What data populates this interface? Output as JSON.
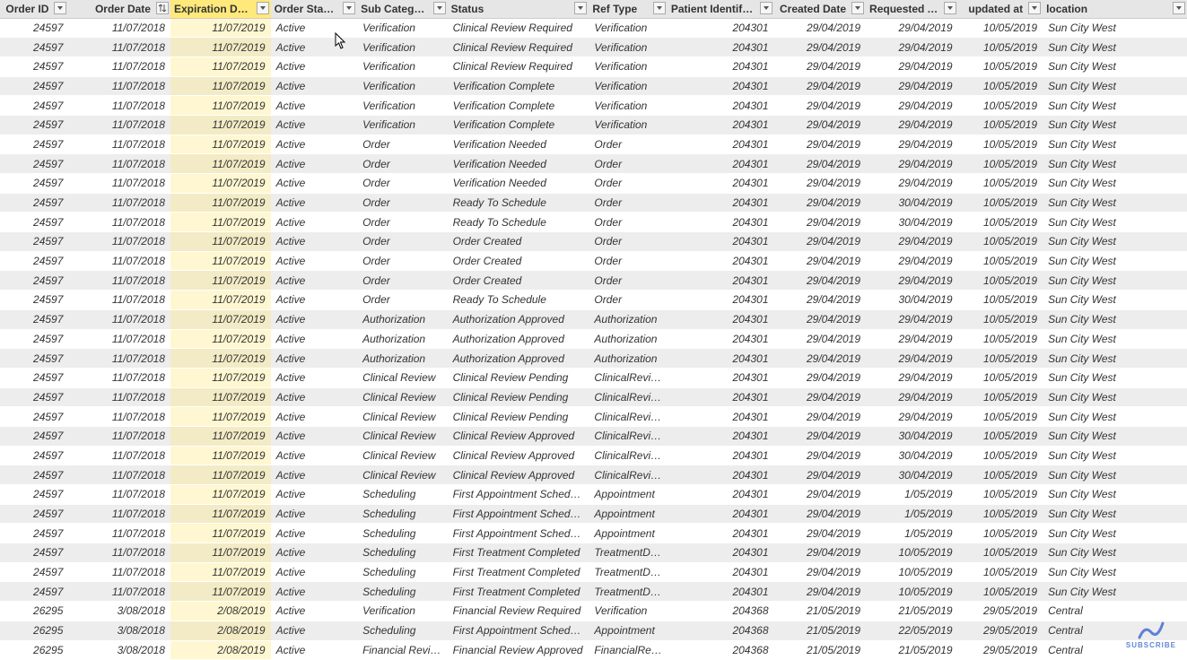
{
  "columns": [
    {
      "key": "order_id",
      "label": "Order ID",
      "align": "right",
      "width": 76,
      "filter": "drop"
    },
    {
      "key": "order_date",
      "label": "Order Date",
      "align": "right",
      "width": 113,
      "filter": "sort"
    },
    {
      "key": "expiration_date",
      "label": "Expiration Date",
      "align": "right",
      "width": 111,
      "filter": "drop",
      "selected": true
    },
    {
      "key": "order_status",
      "label": "Order Status",
      "align": "left",
      "width": 96,
      "filter": "drop"
    },
    {
      "key": "sub_category",
      "label": "Sub Category",
      "align": "left",
      "width": 100,
      "filter": "drop"
    },
    {
      "key": "status",
      "label": "Status",
      "align": "left",
      "width": 157,
      "filter": "drop"
    },
    {
      "key": "ref_type",
      "label": "Ref Type",
      "align": "left",
      "width": 87,
      "filter": "drop"
    },
    {
      "key": "patient_id",
      "label": "Patient Identifier",
      "align": "right",
      "width": 118,
      "filter": "drop"
    },
    {
      "key": "created_date",
      "label": "Created Date",
      "align": "right",
      "width": 102,
      "filter": "drop"
    },
    {
      "key": "requested_at",
      "label": "Requested At",
      "align": "right",
      "width": 102,
      "filter": "drop"
    },
    {
      "key": "updated_at",
      "label": "updated at",
      "align": "right",
      "width": 94,
      "filter": "drop"
    },
    {
      "key": "location",
      "label": "location",
      "align": "left",
      "width": 160,
      "filter": "drop"
    }
  ],
  "rows": [
    {
      "order_id": "24597",
      "order_date": "11/07/2018",
      "expiration_date": "11/07/2019",
      "order_status": "Active",
      "sub_category": "Verification",
      "status": "Clinical Review Required",
      "ref_type": "Verification",
      "patient_id": "204301",
      "created_date": "29/04/2019",
      "requested_at": "29/04/2019",
      "updated_at": "10/05/2019",
      "location": "Sun City West"
    },
    {
      "order_id": "24597",
      "order_date": "11/07/2018",
      "expiration_date": "11/07/2019",
      "order_status": "Active",
      "sub_category": "Verification",
      "status": "Clinical Review Required",
      "ref_type": "Verification",
      "patient_id": "204301",
      "created_date": "29/04/2019",
      "requested_at": "29/04/2019",
      "updated_at": "10/05/2019",
      "location": "Sun City West"
    },
    {
      "order_id": "24597",
      "order_date": "11/07/2018",
      "expiration_date": "11/07/2019",
      "order_status": "Active",
      "sub_category": "Verification",
      "status": "Clinical Review Required",
      "ref_type": "Verification",
      "patient_id": "204301",
      "created_date": "29/04/2019",
      "requested_at": "29/04/2019",
      "updated_at": "10/05/2019",
      "location": "Sun City West"
    },
    {
      "order_id": "24597",
      "order_date": "11/07/2018",
      "expiration_date": "11/07/2019",
      "order_status": "Active",
      "sub_category": "Verification",
      "status": "Verification Complete",
      "ref_type": "Verification",
      "patient_id": "204301",
      "created_date": "29/04/2019",
      "requested_at": "29/04/2019",
      "updated_at": "10/05/2019",
      "location": "Sun City West"
    },
    {
      "order_id": "24597",
      "order_date": "11/07/2018",
      "expiration_date": "11/07/2019",
      "order_status": "Active",
      "sub_category": "Verification",
      "status": "Verification Complete",
      "ref_type": "Verification",
      "patient_id": "204301",
      "created_date": "29/04/2019",
      "requested_at": "29/04/2019",
      "updated_at": "10/05/2019",
      "location": "Sun City West"
    },
    {
      "order_id": "24597",
      "order_date": "11/07/2018",
      "expiration_date": "11/07/2019",
      "order_status": "Active",
      "sub_category": "Verification",
      "status": "Verification Complete",
      "ref_type": "Verification",
      "patient_id": "204301",
      "created_date": "29/04/2019",
      "requested_at": "29/04/2019",
      "updated_at": "10/05/2019",
      "location": "Sun City West"
    },
    {
      "order_id": "24597",
      "order_date": "11/07/2018",
      "expiration_date": "11/07/2019",
      "order_status": "Active",
      "sub_category": "Order",
      "status": "Verification Needed",
      "ref_type": "Order",
      "patient_id": "204301",
      "created_date": "29/04/2019",
      "requested_at": "29/04/2019",
      "updated_at": "10/05/2019",
      "location": "Sun City West"
    },
    {
      "order_id": "24597",
      "order_date": "11/07/2018",
      "expiration_date": "11/07/2019",
      "order_status": "Active",
      "sub_category": "Order",
      "status": "Verification Needed",
      "ref_type": "Order",
      "patient_id": "204301",
      "created_date": "29/04/2019",
      "requested_at": "29/04/2019",
      "updated_at": "10/05/2019",
      "location": "Sun City West"
    },
    {
      "order_id": "24597",
      "order_date": "11/07/2018",
      "expiration_date": "11/07/2019",
      "order_status": "Active",
      "sub_category": "Order",
      "status": "Verification Needed",
      "ref_type": "Order",
      "patient_id": "204301",
      "created_date": "29/04/2019",
      "requested_at": "29/04/2019",
      "updated_at": "10/05/2019",
      "location": "Sun City West"
    },
    {
      "order_id": "24597",
      "order_date": "11/07/2018",
      "expiration_date": "11/07/2019",
      "order_status": "Active",
      "sub_category": "Order",
      "status": "Ready To Schedule",
      "ref_type": "Order",
      "patient_id": "204301",
      "created_date": "29/04/2019",
      "requested_at": "30/04/2019",
      "updated_at": "10/05/2019",
      "location": "Sun City West"
    },
    {
      "order_id": "24597",
      "order_date": "11/07/2018",
      "expiration_date": "11/07/2019",
      "order_status": "Active",
      "sub_category": "Order",
      "status": "Ready To Schedule",
      "ref_type": "Order",
      "patient_id": "204301",
      "created_date": "29/04/2019",
      "requested_at": "30/04/2019",
      "updated_at": "10/05/2019",
      "location": "Sun City West"
    },
    {
      "order_id": "24597",
      "order_date": "11/07/2018",
      "expiration_date": "11/07/2019",
      "order_status": "Active",
      "sub_category": "Order",
      "status": "Order Created",
      "ref_type": "Order",
      "patient_id": "204301",
      "created_date": "29/04/2019",
      "requested_at": "29/04/2019",
      "updated_at": "10/05/2019",
      "location": "Sun City West"
    },
    {
      "order_id": "24597",
      "order_date": "11/07/2018",
      "expiration_date": "11/07/2019",
      "order_status": "Active",
      "sub_category": "Order",
      "status": "Order Created",
      "ref_type": "Order",
      "patient_id": "204301",
      "created_date": "29/04/2019",
      "requested_at": "29/04/2019",
      "updated_at": "10/05/2019",
      "location": "Sun City West"
    },
    {
      "order_id": "24597",
      "order_date": "11/07/2018",
      "expiration_date": "11/07/2019",
      "order_status": "Active",
      "sub_category": "Order",
      "status": "Order Created",
      "ref_type": "Order",
      "patient_id": "204301",
      "created_date": "29/04/2019",
      "requested_at": "29/04/2019",
      "updated_at": "10/05/2019",
      "location": "Sun City West"
    },
    {
      "order_id": "24597",
      "order_date": "11/07/2018",
      "expiration_date": "11/07/2019",
      "order_status": "Active",
      "sub_category": "Order",
      "status": "Ready To Schedule",
      "ref_type": "Order",
      "patient_id": "204301",
      "created_date": "29/04/2019",
      "requested_at": "30/04/2019",
      "updated_at": "10/05/2019",
      "location": "Sun City West"
    },
    {
      "order_id": "24597",
      "order_date": "11/07/2018",
      "expiration_date": "11/07/2019",
      "order_status": "Active",
      "sub_category": "Authorization",
      "status": "Authorization Approved",
      "ref_type": "Authorization",
      "patient_id": "204301",
      "created_date": "29/04/2019",
      "requested_at": "29/04/2019",
      "updated_at": "10/05/2019",
      "location": "Sun City West"
    },
    {
      "order_id": "24597",
      "order_date": "11/07/2018",
      "expiration_date": "11/07/2019",
      "order_status": "Active",
      "sub_category": "Authorization",
      "status": "Authorization Approved",
      "ref_type": "Authorization",
      "patient_id": "204301",
      "created_date": "29/04/2019",
      "requested_at": "29/04/2019",
      "updated_at": "10/05/2019",
      "location": "Sun City West"
    },
    {
      "order_id": "24597",
      "order_date": "11/07/2018",
      "expiration_date": "11/07/2019",
      "order_status": "Active",
      "sub_category": "Authorization",
      "status": "Authorization Approved",
      "ref_type": "Authorization",
      "patient_id": "204301",
      "created_date": "29/04/2019",
      "requested_at": "29/04/2019",
      "updated_at": "10/05/2019",
      "location": "Sun City West"
    },
    {
      "order_id": "24597",
      "order_date": "11/07/2018",
      "expiration_date": "11/07/2019",
      "order_status": "Active",
      "sub_category": "Clinical Review",
      "status": "Clinical Review Pending",
      "ref_type": "ClinicalReview",
      "patient_id": "204301",
      "created_date": "29/04/2019",
      "requested_at": "29/04/2019",
      "updated_at": "10/05/2019",
      "location": "Sun City West"
    },
    {
      "order_id": "24597",
      "order_date": "11/07/2018",
      "expiration_date": "11/07/2019",
      "order_status": "Active",
      "sub_category": "Clinical Review",
      "status": "Clinical Review Pending",
      "ref_type": "ClinicalReview",
      "patient_id": "204301",
      "created_date": "29/04/2019",
      "requested_at": "29/04/2019",
      "updated_at": "10/05/2019",
      "location": "Sun City West"
    },
    {
      "order_id": "24597",
      "order_date": "11/07/2018",
      "expiration_date": "11/07/2019",
      "order_status": "Active",
      "sub_category": "Clinical Review",
      "status": "Clinical Review Pending",
      "ref_type": "ClinicalReview",
      "patient_id": "204301",
      "created_date": "29/04/2019",
      "requested_at": "29/04/2019",
      "updated_at": "10/05/2019",
      "location": "Sun City West"
    },
    {
      "order_id": "24597",
      "order_date": "11/07/2018",
      "expiration_date": "11/07/2019",
      "order_status": "Active",
      "sub_category": "Clinical Review",
      "status": "Clinical Review Approved",
      "ref_type": "ClinicalReview",
      "patient_id": "204301",
      "created_date": "29/04/2019",
      "requested_at": "30/04/2019",
      "updated_at": "10/05/2019",
      "location": "Sun City West"
    },
    {
      "order_id": "24597",
      "order_date": "11/07/2018",
      "expiration_date": "11/07/2019",
      "order_status": "Active",
      "sub_category": "Clinical Review",
      "status": "Clinical Review Approved",
      "ref_type": "ClinicalReview",
      "patient_id": "204301",
      "created_date": "29/04/2019",
      "requested_at": "30/04/2019",
      "updated_at": "10/05/2019",
      "location": "Sun City West"
    },
    {
      "order_id": "24597",
      "order_date": "11/07/2018",
      "expiration_date": "11/07/2019",
      "order_status": "Active",
      "sub_category": "Clinical Review",
      "status": "Clinical Review Approved",
      "ref_type": "ClinicalReview",
      "patient_id": "204301",
      "created_date": "29/04/2019",
      "requested_at": "30/04/2019",
      "updated_at": "10/05/2019",
      "location": "Sun City West"
    },
    {
      "order_id": "24597",
      "order_date": "11/07/2018",
      "expiration_date": "11/07/2019",
      "order_status": "Active",
      "sub_category": "Scheduling",
      "status": "First Appointment Scheduled",
      "ref_type": "Appointment",
      "patient_id": "204301",
      "created_date": "29/04/2019",
      "requested_at": "1/05/2019",
      "updated_at": "10/05/2019",
      "location": "Sun City West"
    },
    {
      "order_id": "24597",
      "order_date": "11/07/2018",
      "expiration_date": "11/07/2019",
      "order_status": "Active",
      "sub_category": "Scheduling",
      "status": "First Appointment Scheduled",
      "ref_type": "Appointment",
      "patient_id": "204301",
      "created_date": "29/04/2019",
      "requested_at": "1/05/2019",
      "updated_at": "10/05/2019",
      "location": "Sun City West"
    },
    {
      "order_id": "24597",
      "order_date": "11/07/2018",
      "expiration_date": "11/07/2019",
      "order_status": "Active",
      "sub_category": "Scheduling",
      "status": "First Appointment Scheduled",
      "ref_type": "Appointment",
      "patient_id": "204301",
      "created_date": "29/04/2019",
      "requested_at": "1/05/2019",
      "updated_at": "10/05/2019",
      "location": "Sun City West"
    },
    {
      "order_id": "24597",
      "order_date": "11/07/2018",
      "expiration_date": "11/07/2019",
      "order_status": "Active",
      "sub_category": "Scheduling",
      "status": "First Treatment Completed",
      "ref_type": "TreatmentDetail",
      "patient_id": "204301",
      "created_date": "29/04/2019",
      "requested_at": "10/05/2019",
      "updated_at": "10/05/2019",
      "location": "Sun City West"
    },
    {
      "order_id": "24597",
      "order_date": "11/07/2018",
      "expiration_date": "11/07/2019",
      "order_status": "Active",
      "sub_category": "Scheduling",
      "status": "First Treatment Completed",
      "ref_type": "TreatmentDetail",
      "patient_id": "204301",
      "created_date": "29/04/2019",
      "requested_at": "10/05/2019",
      "updated_at": "10/05/2019",
      "location": "Sun City West"
    },
    {
      "order_id": "24597",
      "order_date": "11/07/2018",
      "expiration_date": "11/07/2019",
      "order_status": "Active",
      "sub_category": "Scheduling",
      "status": "First Treatment Completed",
      "ref_type": "TreatmentDetail",
      "patient_id": "204301",
      "created_date": "29/04/2019",
      "requested_at": "10/05/2019",
      "updated_at": "10/05/2019",
      "location": "Sun City West"
    },
    {
      "order_id": "26295",
      "order_date": "3/08/2018",
      "expiration_date": "2/08/2019",
      "order_status": "Active",
      "sub_category": "Verification",
      "status": "Financial Review Required",
      "ref_type": "Verification",
      "patient_id": "204368",
      "created_date": "21/05/2019",
      "requested_at": "21/05/2019",
      "updated_at": "29/05/2019",
      "location": "Central"
    },
    {
      "order_id": "26295",
      "order_date": "3/08/2018",
      "expiration_date": "2/08/2019",
      "order_status": "Active",
      "sub_category": "Scheduling",
      "status": "First Appointment Scheduled",
      "ref_type": "Appointment",
      "patient_id": "204368",
      "created_date": "21/05/2019",
      "requested_at": "22/05/2019",
      "updated_at": "29/05/2019",
      "location": "Central"
    },
    {
      "order_id": "26295",
      "order_date": "3/08/2018",
      "expiration_date": "2/08/2019",
      "order_status": "Active",
      "sub_category": "Financial Reviews",
      "status": "Financial Review Approved",
      "ref_type": "FinancialReview",
      "patient_id": "204368",
      "created_date": "21/05/2019",
      "requested_at": "21/05/2019",
      "updated_at": "29/05/2019",
      "location": "Central"
    }
  ],
  "badge": {
    "label": "SUBSCRIBE"
  }
}
